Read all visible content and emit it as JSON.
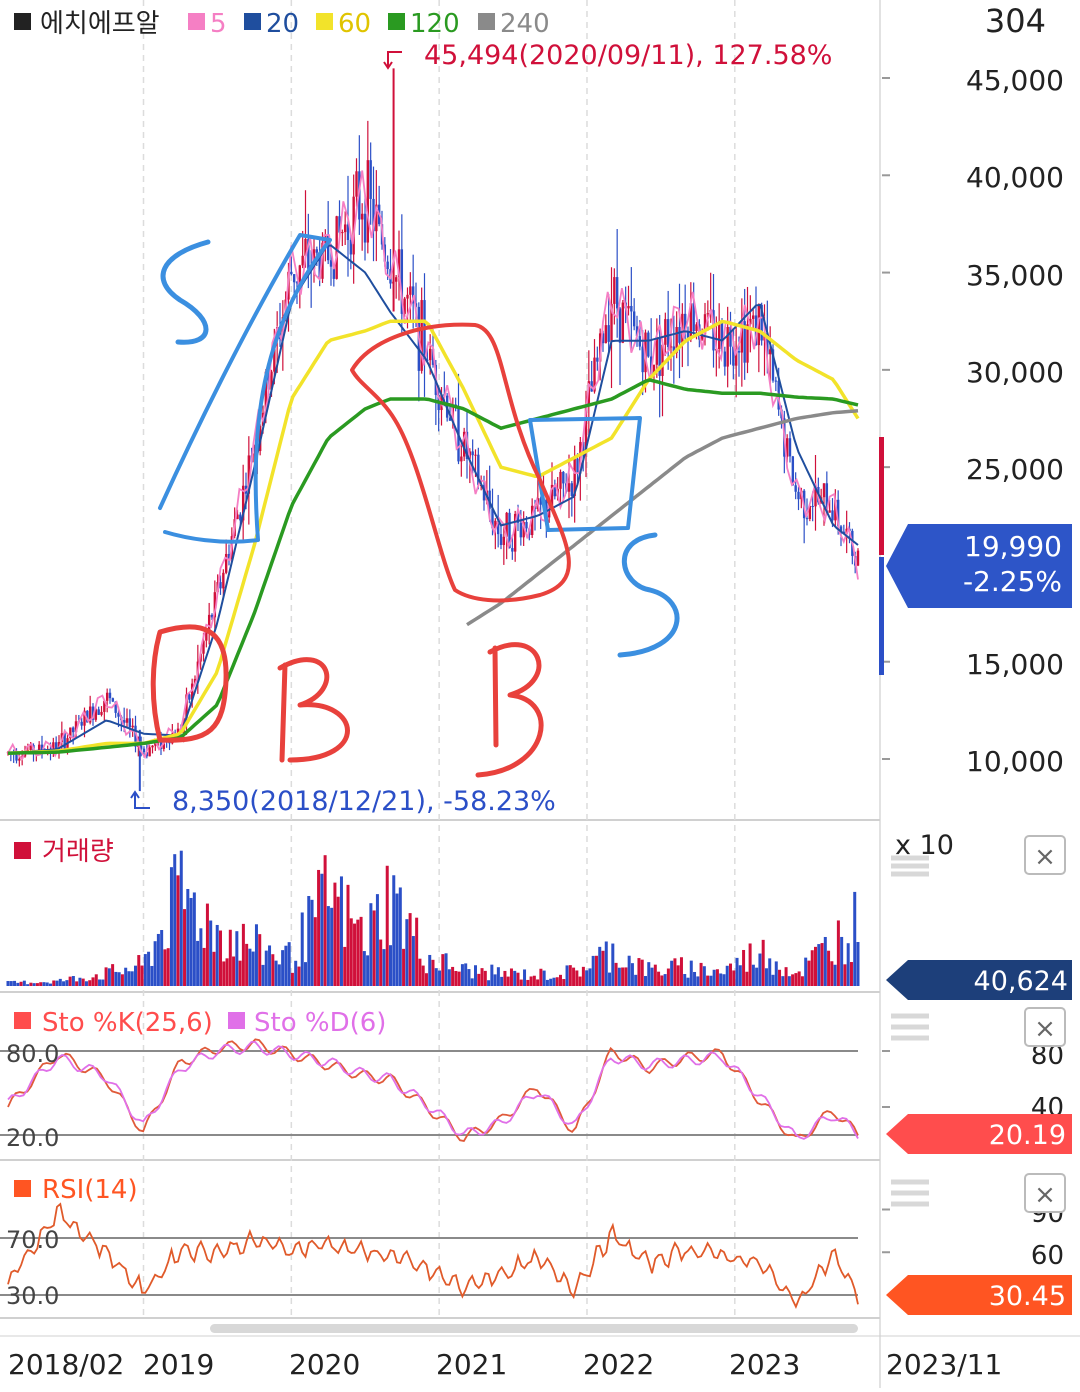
{
  "price_panel": {
    "symbol": "에치에프알",
    "period_labels": [
      "5",
      "20",
      "60",
      "120",
      "240"
    ],
    "top_value": "304",
    "y_ticks": [
      "45,000",
      "40,000",
      "35,000",
      "30,000",
      "25,000",
      "15,000",
      "10,000"
    ],
    "current_price": "19,990",
    "current_change": "-2.25%",
    "high_note": "45,494(2020/09/11), 127.58%",
    "low_note": "8,350(2018/12/21), -58.23%",
    "colors": {
      "up": "#d0103a",
      "down": "#2b4fc7",
      "ma5": "#f57fc4",
      "ma20": "#1f4e9e",
      "ma60": "#f2e32a",
      "ma120": "#2a9a21",
      "ma240": "#8a8a8a",
      "price_badge": "#2d55c8"
    }
  },
  "volume_panel": {
    "title": "거래량",
    "unit": "x 10",
    "current": "40,624",
    "close_icon": "×",
    "badge_color": "#1d3f7a"
  },
  "stoch_panel": {
    "k_label": "Sto %K(25,6)",
    "d_label": "Sto %D(6)",
    "levels": [
      "80.0",
      "20.0"
    ],
    "right_ticks": [
      "80",
      "40"
    ],
    "current": "20.19",
    "close_icon": "×",
    "badge_color": "#ff4d4d"
  },
  "rsi_panel": {
    "label": "RSI(14)",
    "levels": [
      "70.0",
      "30.0"
    ],
    "right_ticks": [
      "90",
      "60"
    ],
    "current": "30.45",
    "close_icon": "×",
    "badge_color": "#ff5522"
  },
  "x_axis": {
    "labels": [
      "2018/02",
      "2019",
      "2020",
      "2021",
      "2022",
      "2023"
    ],
    "current_period": "2023/11"
  },
  "annotations": {
    "handwriting": [
      "S",
      "B",
      "B",
      "S"
    ],
    "note_colors": {
      "blue": "#3b8fe0",
      "red": "#e8413c"
    }
  },
  "chart_data": [
    {
      "type": "line",
      "title": "에치에프알",
      "x": [
        "2018-02",
        "2018-06",
        "2018-10",
        "2019-01",
        "2019-04",
        "2019-07",
        "2019-10",
        "2020-01",
        "2020-04",
        "2020-07",
        "2020-09",
        "2020-12",
        "2021-03",
        "2021-06",
        "2021-09",
        "2021-12",
        "2022-03",
        "2022-06",
        "2022-09",
        "2022-12",
        "2023-03",
        "2023-06",
        "2023-09",
        "2023-11"
      ],
      "series": [
        {
          "name": "close",
          "values": [
            10300,
            10600,
            13200,
            10400,
            11500,
            18500,
            26000,
            35000,
            36000,
            39000,
            35500,
            31000,
            26000,
            21500,
            22500,
            24500,
            34000,
            30500,
            33000,
            31500,
            32500,
            23500,
            23000,
            19990
          ]
        },
        {
          "name": "20",
          "values": [
            10300,
            10500,
            12000,
            11300,
            11200,
            17000,
            25000,
            33500,
            36500,
            35000,
            33000,
            30500,
            26000,
            22000,
            22500,
            23500,
            31500,
            31500,
            32000,
            31500,
            33500,
            26000,
            22000,
            21000
          ]
        },
        {
          "name": "60",
          "values": [
            10300,
            10400,
            10800,
            10800,
            11300,
            14500,
            21000,
            28500,
            31500,
            32000,
            32500,
            32500,
            29000,
            25000,
            24500,
            25500,
            26500,
            29500,
            31500,
            32500,
            32000,
            30500,
            29500,
            27500
          ]
        },
        {
          "name": "120",
          "values": [
            10300,
            10350,
            10600,
            10800,
            11100,
            12800,
            17500,
            23000,
            26500,
            28000,
            28500,
            28500,
            28000,
            27000,
            27500,
            28000,
            28500,
            29500,
            29000,
            28800,
            28800,
            28600,
            28500,
            28200
          ]
        },
        {
          "name": "240",
          "values": [
            null,
            null,
            null,
            null,
            null,
            null,
            null,
            null,
            null,
            null,
            null,
            null,
            16800,
            18000,
            19500,
            21000,
            22500,
            24000,
            25500,
            26500,
            27000,
            27500,
            27800,
            27900
          ]
        }
      ],
      "ylim": [
        8000,
        47000
      ],
      "high": {
        "value": 45494,
        "date": "2020/09/11"
      },
      "low": {
        "value": 8350,
        "date": "2018/12/21"
      }
    },
    {
      "type": "bar",
      "title": "거래량",
      "x": [
        "2018-02",
        "2018-06",
        "2018-10",
        "2019-01",
        "2019-04",
        "2019-07",
        "2019-10",
        "2020-01",
        "2020-04",
        "2020-07",
        "2020-09",
        "2020-12",
        "2021-03",
        "2021-06",
        "2021-09",
        "2021-12",
        "2022-03",
        "2022-06",
        "2022-09",
        "2022-12",
        "2023-03",
        "2023-06",
        "2023-09",
        "2023-11"
      ],
      "values": [
        2000,
        3000,
        8000,
        13000,
        60000,
        35000,
        25000,
        18000,
        58000,
        30000,
        58000,
        18000,
        10000,
        8000,
        7000,
        9000,
        22000,
        10000,
        12000,
        9000,
        22000,
        8000,
        28000,
        40624
      ]
    },
    {
      "type": "line",
      "title": "Sto %K(25,6) / Sto %D(6)",
      "x": [
        "2018-02",
        "2018-06",
        "2018-10",
        "2019-01",
        "2019-04",
        "2019-07",
        "2019-10",
        "2020-01",
        "2020-04",
        "2020-07",
        "2020-09",
        "2020-12",
        "2021-03",
        "2021-06",
        "2021-09",
        "2021-12",
        "2022-03",
        "2022-06",
        "2022-09",
        "2022-12",
        "2023-03",
        "2023-06",
        "2023-09",
        "2023-11"
      ],
      "series": [
        {
          "name": "Sto %K(25,6)",
          "values": [
            40,
            78,
            60,
            22,
            72,
            82,
            85,
            78,
            70,
            62,
            60,
            40,
            18,
            30,
            55,
            22,
            80,
            68,
            75,
            78,
            45,
            15,
            38,
            20
          ]
        },
        {
          "name": "Sto %D(6)",
          "values": [
            42,
            75,
            62,
            26,
            68,
            80,
            83,
            78,
            72,
            63,
            60,
            42,
            20,
            28,
            52,
            25,
            76,
            70,
            73,
            76,
            48,
            17,
            35,
            21
          ]
        }
      ],
      "ylim": [
        0,
        100
      ],
      "levels": [
        80,
        20
      ]
    },
    {
      "type": "line",
      "title": "RSI(14)",
      "x": [
        "2018-02",
        "2018-06",
        "2018-10",
        "2019-01",
        "2019-04",
        "2019-07",
        "2019-10",
        "2020-01",
        "2020-04",
        "2020-07",
        "2020-09",
        "2020-12",
        "2021-03",
        "2021-06",
        "2021-09",
        "2021-12",
        "2022-03",
        "2022-06",
        "2022-09",
        "2022-12",
        "2023-03",
        "2023-06",
        "2023-09",
        "2023-11"
      ],
      "series": [
        {
          "name": "RSI(14)",
          "values": [
            40,
            88,
            60,
            32,
            62,
            60,
            68,
            62,
            66,
            60,
            58,
            48,
            35,
            45,
            55,
            35,
            72,
            52,
            62,
            58,
            52,
            25,
            58,
            30.45
          ]
        }
      ],
      "ylim": [
        20,
        100
      ],
      "levels": [
        70,
        30
      ]
    }
  ]
}
